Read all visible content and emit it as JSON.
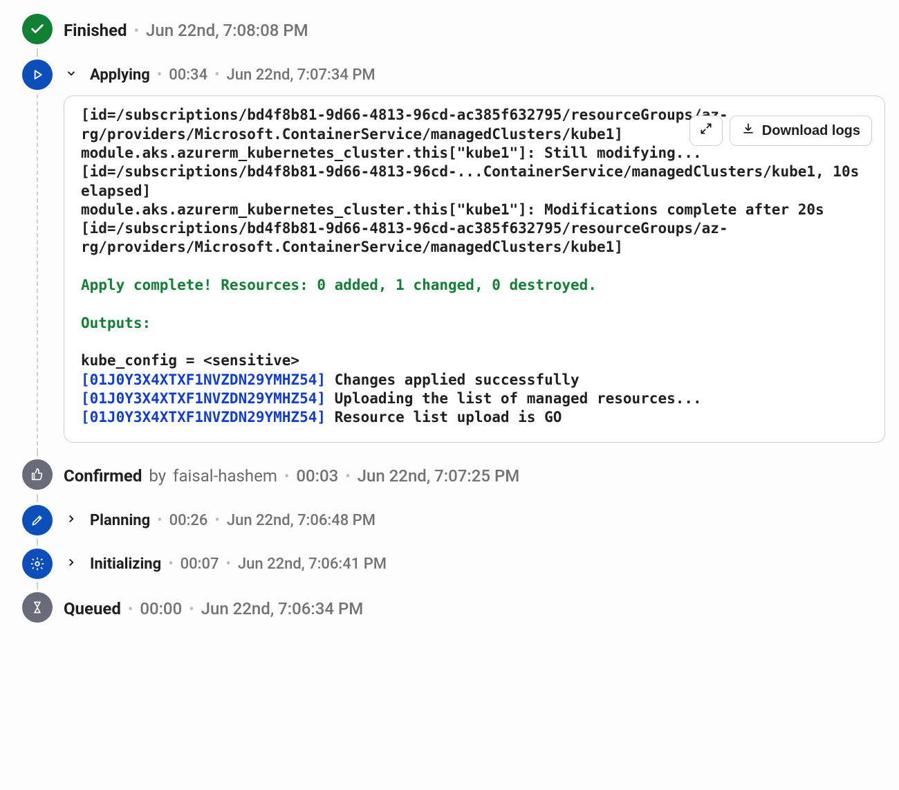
{
  "steps": {
    "finished": {
      "title": "Finished",
      "timestamp": "Jun 22nd, 7:08:08 PM"
    },
    "applying": {
      "title": "Applying",
      "duration": "00:34",
      "timestamp": "Jun 22nd, 7:07:34 PM"
    },
    "confirmed": {
      "title": "Confirmed",
      "by_label": "by",
      "by_name": "faisal-hashem",
      "duration": "00:03",
      "timestamp": "Jun 22nd, 7:07:25 PM"
    },
    "planning": {
      "title": "Planning",
      "duration": "00:26",
      "timestamp": "Jun 22nd, 7:06:48 PM"
    },
    "initializing": {
      "title": "Initializing",
      "duration": "00:07",
      "timestamp": "Jun 22nd, 7:06:41 PM"
    },
    "queued": {
      "title": "Queued",
      "duration": "00:00",
      "timestamp": "Jun 22nd, 7:06:34 PM"
    }
  },
  "actions": {
    "download_logs": "Download logs"
  },
  "log": {
    "line1": "[id=/subscriptions/bd4f8b81-9d66-4813-96cd-ac385f632795/resourceGroups/az-rg/providers/Microsoft.ContainerService/managedClusters/kube1]",
    "line2": "module.aks.azurerm_kubernetes_cluster.this[\"kube1\"]: Still modifying... [id=/subscriptions/bd4f8b81-9d66-4813-96cd-...ContainerService/managedClusters/kube1, 10s elapsed]",
    "line3": "module.aks.azurerm_kubernetes_cluster.this[\"kube1\"]: Modifications complete after 20s [id=/subscriptions/bd4f8b81-9d66-4813-96cd-ac385f632795/resourceGroups/az-rg/providers/Microsoft.ContainerService/managedClusters/kube1]",
    "apply_complete": "Apply complete! Resources: 0 added, 1 changed, 0 destroyed.",
    "outputs_header": "Outputs:",
    "output_kv": "kube_config = <sensitive>",
    "trace_id": "[01J0Y3X4XTXF1NVZDN29YMHZ54]",
    "msg1": " Changes applied successfully",
    "msg2": " Uploading the list of managed resources...",
    "msg3": " Resource list upload is GO"
  }
}
